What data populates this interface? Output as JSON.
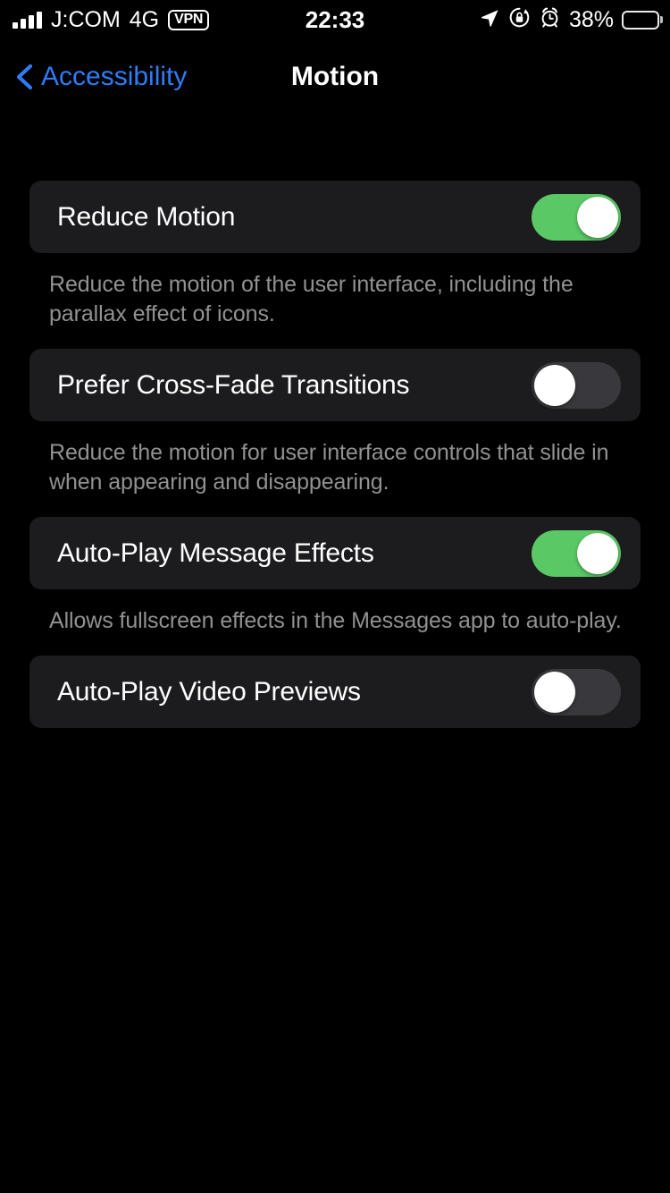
{
  "status_bar": {
    "carrier": "J:COM",
    "network_type": "4G",
    "vpn_label": "VPN",
    "time": "22:33",
    "battery_percent": "38%",
    "battery_level": 38,
    "icons": {
      "signal": "signal-bars-icon",
      "location": "location-arrow-icon",
      "rotation_lock": "rotation-lock-icon",
      "alarm": "alarm-clock-icon",
      "battery": "battery-icon"
    }
  },
  "nav_bar": {
    "back_label": "Accessibility",
    "title": "Motion",
    "back_icon": "chevron-left-icon",
    "accent_color": "#2f7cf6"
  },
  "colors": {
    "page_background": "#000000",
    "card_background": "#1c1c1e",
    "toggle_on": "#5ac865",
    "toggle_off": "#39393d",
    "primary_text": "#ffffff",
    "secondary_text": "#919193",
    "accent": "#2f7cf6"
  },
  "settings": [
    {
      "label": "Reduce Motion",
      "toggle_state": "on",
      "toggle_name": "reduce-motion-toggle",
      "description": "Reduce the motion of the user interface, including the parallax effect of icons."
    },
    {
      "label": "Prefer Cross-Fade Transitions",
      "toggle_state": "off",
      "toggle_name": "prefer-cross-fade-transitions-toggle",
      "description": "Reduce the motion for user interface controls that slide in when appearing and disappearing."
    },
    {
      "label": "Auto-Play Message Effects",
      "toggle_state": "on",
      "toggle_name": "auto-play-message-effects-toggle",
      "description": "Allows fullscreen effects in the Messages app to auto-play."
    },
    {
      "label": "Auto-Play Video Previews",
      "toggle_state": "off",
      "toggle_name": "auto-play-video-previews-toggle",
      "description": ""
    }
  ]
}
